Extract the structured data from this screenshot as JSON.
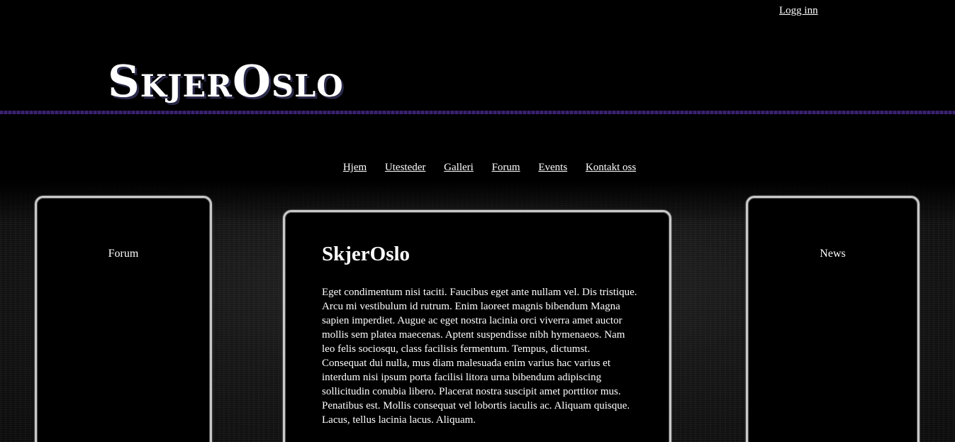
{
  "header": {
    "login_label": "Logg inn",
    "logo_text": "SkjerOslo"
  },
  "nav": {
    "items": [
      {
        "label": "Hjem"
      },
      {
        "label": "Utesteder"
      },
      {
        "label": "Galleri"
      },
      {
        "label": "Forum"
      },
      {
        "label": "Events"
      },
      {
        "label": "Kontakt oss"
      }
    ]
  },
  "left_panel": {
    "title": "Forum"
  },
  "right_panel": {
    "title": "News"
  },
  "main": {
    "title": "SkjerOslo",
    "body": "Eget condimentum nisi taciti. Faucibus eget ante nullam vel. Dis tristique. Arcu mi vestibulum id rutrum. Enim laoreet magnis bibendum Magna sapien imperdiet. Augue ac eget nostra lacinia orci viverra amet auctor mollis sem platea maecenas. Aptent suspendisse nibh hymenaeos. Nam leo felis sociosqu, class facilisis fermentum. Tempus, dictumst. Consequat dui nulla, mus diam malesuada enim varius hac varius et interdum nisi ipsum porta facilisi litora urna bibendum adipiscing sollicitudin conubia libero. Placerat nostra suscipit amet porttitor mus. Penatibus est. Mollis consequat vel lobortis iaculis ac. Aliquam quisque. Lacus, tellus lacinia lacus. Aliquam."
  },
  "colors": {
    "background": "#000000",
    "accent_stripe": "#3a2270",
    "panel_border": "#c8c8c8",
    "text": "#ffffff"
  }
}
